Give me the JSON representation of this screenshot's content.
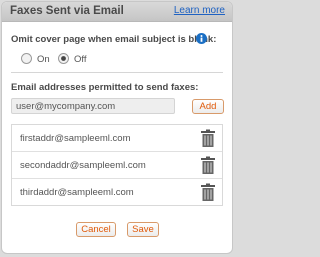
{
  "header": {
    "title": "Faxes Sent via Email",
    "learn_more": "Learn more"
  },
  "cover_page": {
    "label": "Omit cover page when email subject is blank:",
    "options": [
      "On",
      "Off"
    ],
    "selected": "Off"
  },
  "addresses": {
    "label": "Email addresses permitted to send faxes:",
    "input_placeholder": "user@mycompany.com",
    "add_label": "Add",
    "items": [
      "firstaddr@sampleeml.com",
      "secondaddr@sampleeml.com",
      "thirdaddr@sampleeml.com"
    ]
  },
  "footer": {
    "cancel_label": "Cancel",
    "save_label": "Save"
  },
  "icons": {
    "info": "info-icon",
    "delete": "trash-icon"
  },
  "colors": {
    "accent": "#e05a0a",
    "link": "#1f62c2",
    "info": "#1b6fc4"
  }
}
